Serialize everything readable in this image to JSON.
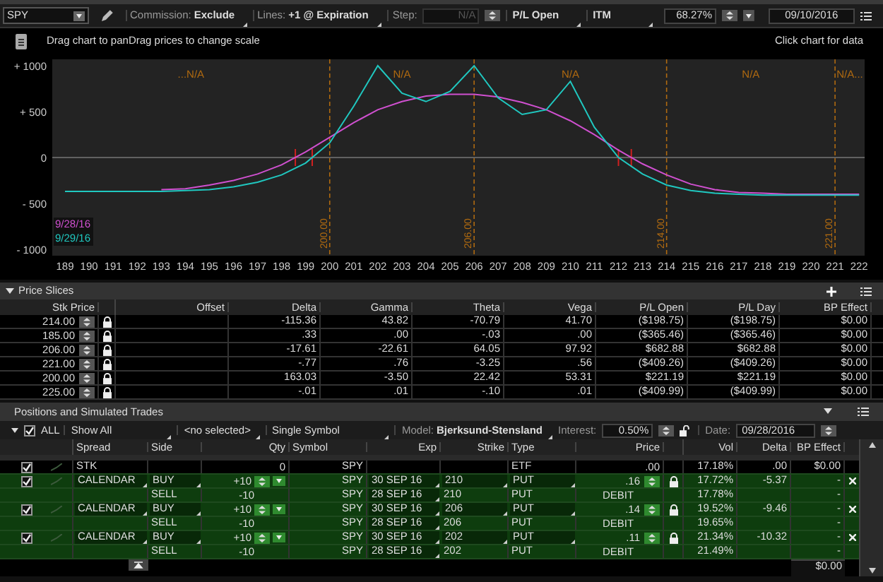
{
  "toolbar": {
    "symbol": "SPY",
    "commission_label": "Commission:",
    "commission": "Exclude",
    "lines_label": "Lines:",
    "lines": "+1 @ Expiration",
    "step_label": "Step:",
    "step": "N/A",
    "pl_mode": "P/L Open",
    "itm": "ITM",
    "probability": "68.27%",
    "date": "09/10/2016"
  },
  "chart_header": {
    "hint": "Drag chart to panDrag prices to change scale",
    "action": "Click chart for data"
  },
  "chart": {
    "chart_data": {
      "type": "line",
      "x": [
        189,
        190,
        191,
        192,
        193,
        194,
        195,
        196,
        197,
        198,
        199,
        200,
        201,
        202,
        203,
        204,
        205,
        206,
        207,
        208,
        209,
        210,
        211,
        212,
        213,
        214,
        215,
        216,
        217,
        218,
        219,
        220,
        221,
        222
      ],
      "series": [
        {
          "name": "9/28/16",
          "color": "#d050d0",
          "values": [
            null,
            null,
            null,
            null,
            -350,
            -340,
            -300,
            -250,
            -180,
            -80,
            60,
            220,
            380,
            520,
            610,
            670,
            690,
            690,
            660,
            600,
            520,
            400,
            250,
            80,
            -70,
            -190,
            -290,
            -350,
            -380,
            -390,
            -400,
            -400,
            -400,
            -400
          ]
        },
        {
          "name": "9/29/16",
          "color": "#20c8c0",
          "values": [
            -370,
            -370,
            -370,
            -370,
            -370,
            -360,
            -350,
            -320,
            -270,
            -190,
            -60,
            160,
            560,
            1000,
            700,
            610,
            720,
            1000,
            650,
            470,
            520,
            830,
            330,
            0,
            -180,
            -300,
            -360,
            -390,
            -400,
            -410,
            -410,
            -410,
            -410,
            -410
          ]
        }
      ],
      "xlim": [
        188.47,
        222.23
      ],
      "ylim": [
        -1070,
        1070
      ],
      "xticks": [
        189,
        190,
        191,
        192,
        193,
        194,
        195,
        196,
        197,
        198,
        199,
        200,
        201,
        202,
        203,
        204,
        205,
        206,
        207,
        208,
        209,
        210,
        211,
        212,
        213,
        214,
        215,
        216,
        217,
        218,
        219,
        220,
        221,
        222
      ],
      "yticks": [
        {
          "value": 1000,
          "label": "+ 1000"
        },
        {
          "value": 500,
          "label": "+ 500"
        },
        {
          "value": 0,
          "label": "0"
        },
        {
          "value": -500,
          "label": "- 500"
        },
        {
          "value": -1000,
          "label": "- 1000"
        }
      ],
      "ref_lines": [
        {
          "axis": "y",
          "value": 0
        },
        {
          "axis": "x",
          "value": 200,
          "label": "200.00"
        },
        {
          "axis": "x",
          "value": 206,
          "label": "206.00"
        },
        {
          "axis": "x",
          "value": 214,
          "label": "214.00"
        },
        {
          "axis": "x",
          "value": 221,
          "label": "221.00"
        }
      ],
      "annotations": [
        "...N/A",
        "N/A",
        "N/A",
        "N/A",
        "N/A..."
      ]
    }
  },
  "price_slices": {
    "title": "Price Slices",
    "columns": [
      "Stk Price",
      "Offset",
      "Delta",
      "Gamma",
      "Theta",
      "Vega",
      "P/L Open",
      "P/L Day",
      "BP Effect"
    ],
    "rows": [
      {
        "stk_price": "214.00",
        "delta": "-115.36",
        "gamma": "43.82",
        "theta": "-70.79",
        "vega": "41.70",
        "pl_open": "($198.75)",
        "pl_day": "($198.75)",
        "bp_effect": "$0.00"
      },
      {
        "stk_price": "185.00",
        "delta": ".33",
        "gamma": ".00",
        "theta": "-.03",
        "vega": ".00",
        "pl_open": "($365.46)",
        "pl_day": "($365.46)",
        "bp_effect": "$0.00"
      },
      {
        "stk_price": "206.00",
        "delta": "-17.61",
        "gamma": "-22.61",
        "theta": "64.05",
        "vega": "97.92",
        "pl_open": "$682.88",
        "pl_day": "$682.88",
        "bp_effect": "$0.00"
      },
      {
        "stk_price": "221.00",
        "delta": "-.77",
        "gamma": ".76",
        "theta": "-3.25",
        "vega": ".56",
        "pl_open": "($409.26)",
        "pl_day": "($409.26)",
        "bp_effect": "$0.00"
      },
      {
        "stk_price": "200.00",
        "delta": "163.03",
        "gamma": "-3.50",
        "theta": "22.42",
        "vega": "53.31",
        "pl_open": "$221.19",
        "pl_day": "$221.19",
        "bp_effect": "$0.00"
      },
      {
        "stk_price": "225.00",
        "delta": "-.01",
        "gamma": ".01",
        "theta": "-.10",
        "vega": ".01",
        "pl_open": "($409.99)",
        "pl_day": "($409.99)",
        "bp_effect": "$0.00"
      }
    ]
  },
  "positions": {
    "title": "Positions and Simulated Trades",
    "toolbar": {
      "all_checked": true,
      "all_label": "ALL",
      "show": "Show All",
      "selection": "<no selected>",
      "mode": "Single Symbol",
      "model_label": "Model:",
      "model": "Bjerksund-Stensland",
      "interest_label": "Interest:",
      "interest": "0.50%",
      "date_label": "Date:",
      "date": "09/28/2016"
    },
    "columns": [
      "Spread",
      "Side",
      "Qty",
      "Symbol",
      "Exp",
      "Strike",
      "Type",
      "Price",
      "Vol",
      "Delta",
      "BP Effect"
    ],
    "groups": [
      {
        "kind": "stock",
        "checked": true,
        "spread": "STK",
        "legs": [
          {
            "qty": "0",
            "symbol": "SPY",
            "type": "ETF",
            "price": ".00",
            "vol": "17.18%",
            "delta": ".00",
            "bp_effect": "$0.00"
          }
        ]
      },
      {
        "kind": "calendar",
        "checked": true,
        "spread": "CALENDAR",
        "legs": [
          {
            "side": "BUY",
            "qty": "+10",
            "symbol": "SPY",
            "exp": "30 SEP 16",
            "strike": "210",
            "type": "PUT",
            "price": ".16",
            "vol": "17.72%",
            "delta": "-5.37",
            "bp_effect": "-"
          },
          {
            "side": "SELL",
            "qty": "-10",
            "symbol": "SPY",
            "exp": "28 SEP 16",
            "strike": "210",
            "type": "PUT",
            "price": "DEBIT",
            "vol": "17.78%",
            "bp_effect": "-"
          }
        ]
      },
      {
        "kind": "calendar",
        "checked": true,
        "spread": "CALENDAR",
        "legs": [
          {
            "side": "BUY",
            "qty": "+10",
            "symbol": "SPY",
            "exp": "30 SEP 16",
            "strike": "206",
            "type": "PUT",
            "price": ".14",
            "vol": "19.52%",
            "delta": "-9.46",
            "bp_effect": "-"
          },
          {
            "side": "SELL",
            "qty": "-10",
            "symbol": "SPY",
            "exp": "28 SEP 16",
            "strike": "206",
            "type": "PUT",
            "price": "DEBIT",
            "vol": "19.65%",
            "bp_effect": "-"
          }
        ]
      },
      {
        "kind": "calendar",
        "checked": true,
        "spread": "CALENDAR",
        "legs": [
          {
            "side": "BUY",
            "qty": "+10",
            "symbol": "SPY",
            "exp": "30 SEP 16",
            "strike": "202",
            "type": "PUT",
            "price": ".11",
            "vol": "21.34%",
            "delta": "-10.32",
            "bp_effect": "-"
          },
          {
            "side": "SELL",
            "qty": "-10",
            "symbol": "SPY",
            "exp": "28 SEP 16",
            "strike": "202",
            "type": "PUT",
            "price": "DEBIT",
            "vol": "21.49%",
            "bp_effect": "-"
          }
        ]
      }
    ],
    "total_bp_effect": "$0.00"
  }
}
